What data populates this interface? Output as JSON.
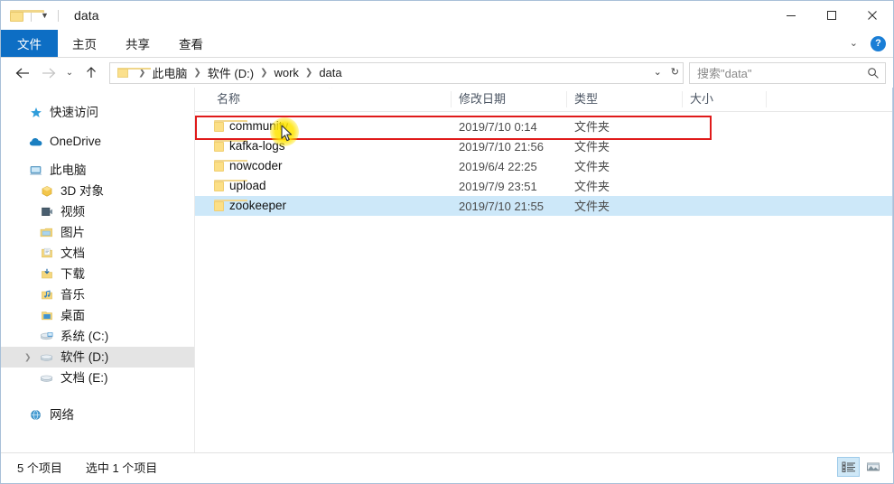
{
  "window": {
    "title": "data",
    "quick_access_icon": "folder-icon",
    "quick_access_dropdown_icon": "chevron-down-icon",
    "minimize_icon": "minimize-icon",
    "maximize_icon": "maximize-icon",
    "close_icon": "close-icon"
  },
  "ribbon": {
    "tabs": [
      {
        "label": "文件",
        "active": true
      },
      {
        "label": "主页",
        "active": false
      },
      {
        "label": "共享",
        "active": false
      },
      {
        "label": "查看",
        "active": false
      }
    ],
    "collapse_icon": "chevron-down-icon",
    "help_label": "?",
    "accent_color": "#0d6ec4",
    "help_color": "#1a7ed6"
  },
  "navigation": {
    "back_icon": "arrow-left-icon",
    "forward_icon": "arrow-right-icon",
    "recent_icon": "chevron-down-icon",
    "up_icon": "arrow-up-icon",
    "breadcrumb_icon": "folder-icon",
    "breadcrumbs": [
      "此电脑",
      "软件 (D:)",
      "work",
      "data"
    ],
    "breadcrumb_dropdown_icon": "chevron-down-icon",
    "refresh_icon": "refresh-icon"
  },
  "search": {
    "placeholder": "搜索\"data\"",
    "icon": "search-icon"
  },
  "sidebar": {
    "items": [
      {
        "label": "快速访问",
        "icon": "star-icon",
        "indent": false,
        "selected": false,
        "expander": false
      },
      {
        "label": "OneDrive",
        "icon": "cloud-icon",
        "indent": false,
        "selected": false,
        "expander": false
      },
      {
        "label": "此电脑",
        "icon": "computer-icon",
        "indent": false,
        "selected": false,
        "expander": false
      },
      {
        "label": "3D 对象",
        "icon": "3d-objects-icon",
        "indent": true,
        "selected": false,
        "expander": false
      },
      {
        "label": "视频",
        "icon": "videos-icon",
        "indent": true,
        "selected": false,
        "expander": false
      },
      {
        "label": "图片",
        "icon": "pictures-icon",
        "indent": true,
        "selected": false,
        "expander": false
      },
      {
        "label": "文档",
        "icon": "documents-icon",
        "indent": true,
        "selected": false,
        "expander": false
      },
      {
        "label": "下载",
        "icon": "downloads-icon",
        "indent": true,
        "selected": false,
        "expander": false
      },
      {
        "label": "音乐",
        "icon": "music-icon",
        "indent": true,
        "selected": false,
        "expander": false
      },
      {
        "label": "桌面",
        "icon": "desktop-icon",
        "indent": true,
        "selected": false,
        "expander": false
      },
      {
        "label": "系统 (C:)",
        "icon": "system-drive-icon",
        "indent": true,
        "selected": false,
        "expander": false
      },
      {
        "label": "软件 (D:)",
        "icon": "drive-icon",
        "indent": true,
        "selected": true,
        "expander": true
      },
      {
        "label": "文档 (E:)",
        "icon": "drive-icon",
        "indent": true,
        "selected": false,
        "expander": false
      },
      {
        "label": "网络",
        "icon": "network-icon",
        "indent": false,
        "selected": false,
        "expander": false
      }
    ]
  },
  "filelist": {
    "columns": [
      "名称",
      "修改日期",
      "类型",
      "大小"
    ],
    "sort_indicator": "sort-ascending-icon",
    "rows": [
      {
        "name": "community",
        "date": "2019/7/10 0:14",
        "type": "文件夹",
        "size": "",
        "icon": "folder-icon",
        "selected": false
      },
      {
        "name": "kafka-logs",
        "date": "2019/7/10 21:56",
        "type": "文件夹",
        "size": "",
        "icon": "folder-icon",
        "selected": false
      },
      {
        "name": "nowcoder",
        "date": "2019/6/4 22:25",
        "type": "文件夹",
        "size": "",
        "icon": "folder-icon",
        "selected": false
      },
      {
        "name": "upload",
        "date": "2019/7/9 23:51",
        "type": "文件夹",
        "size": "",
        "icon": "folder-icon",
        "selected": false
      },
      {
        "name": "zookeeper",
        "date": "2019/7/10 21:55",
        "type": "文件夹",
        "size": "",
        "icon": "folder-icon",
        "selected": true
      }
    ],
    "selection_color": "#cde8f9",
    "annotation_color": "#e01b1b",
    "cursor_highlight_color": "#ffe400"
  },
  "statusbar": {
    "item_count": "5 个项目",
    "selection_count": "选中 1 个项目",
    "details_view_icon": "details-view-icon",
    "large_icons_view_icon": "large-icons-view-icon"
  }
}
